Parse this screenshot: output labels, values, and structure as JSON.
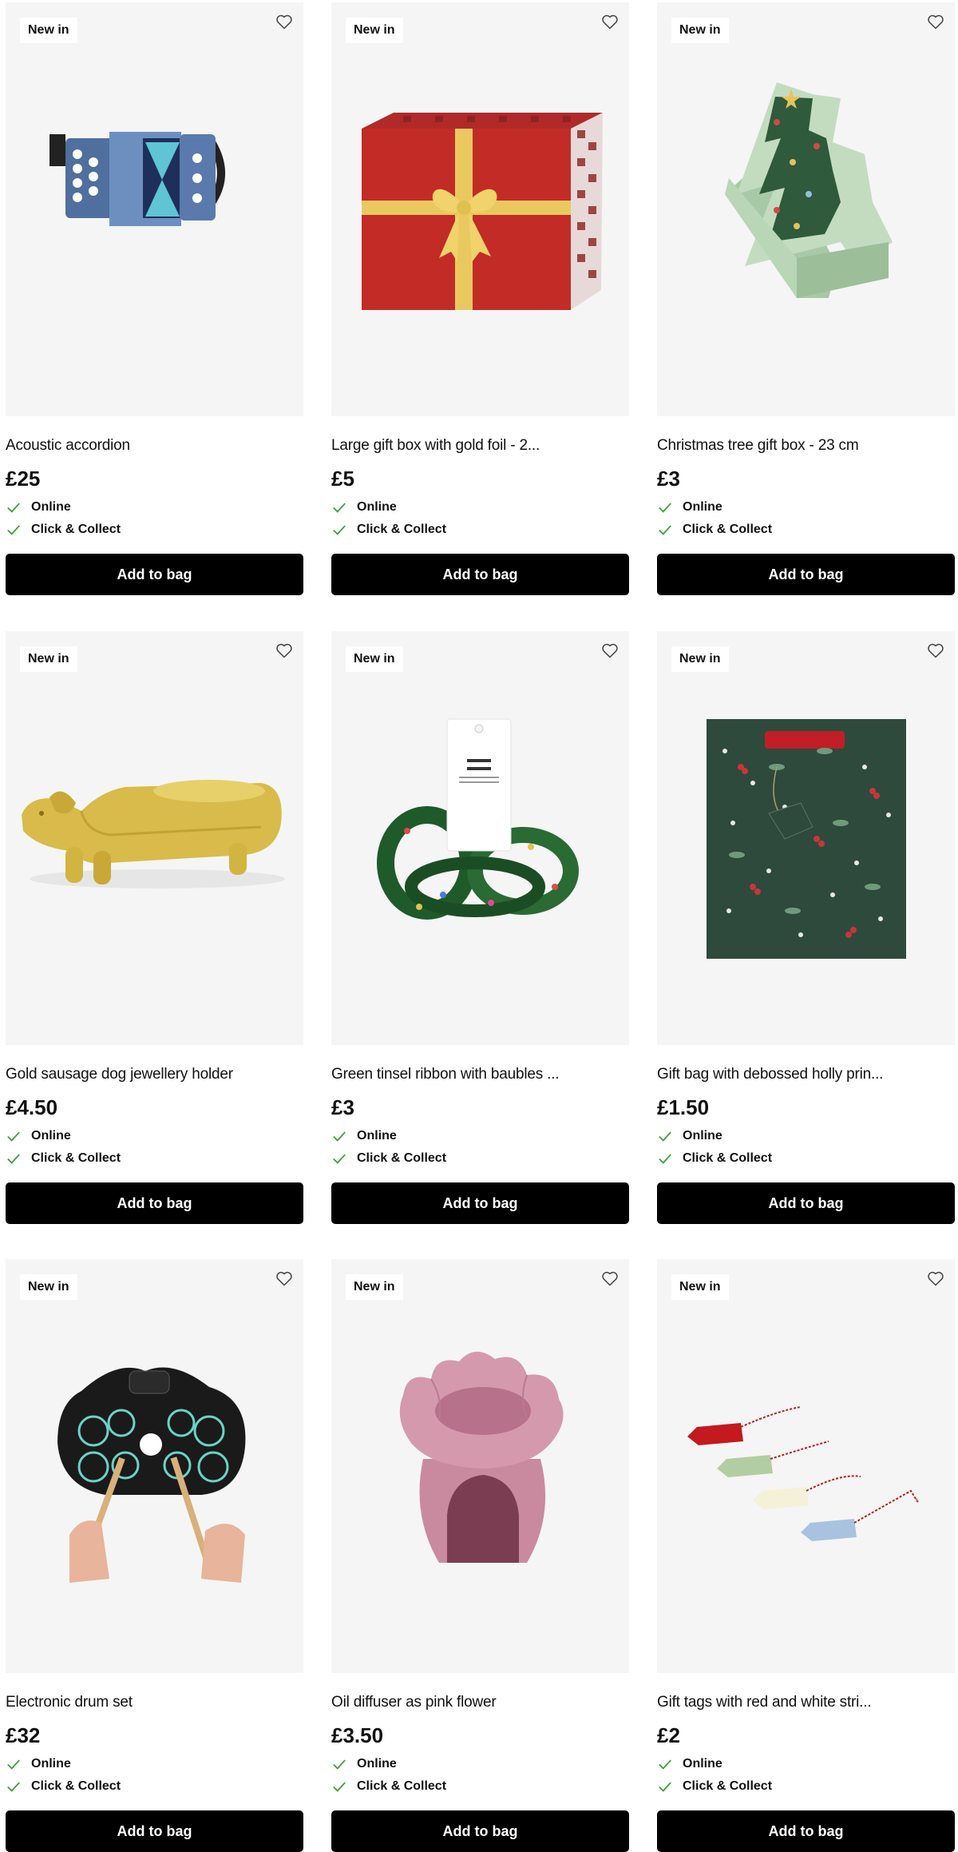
{
  "colors": {
    "button_bg": "#000000",
    "button_text": "#ffffff",
    "check": "#3aa335",
    "image_bg": "#f5f5f5"
  },
  "products": [
    {
      "badge": "New in",
      "title": "Acoustic accordion",
      "price": "£25",
      "availability": [
        "Online",
        "Click & Collect"
      ],
      "button": "Add to bag",
      "image_icon": "accordion-image"
    },
    {
      "badge": "New in",
      "title": "Large gift box with gold foil - 2...",
      "price": "£5",
      "availability": [
        "Online",
        "Click & Collect"
      ],
      "button": "Add to bag",
      "image_icon": "gift-box-image"
    },
    {
      "badge": "New in",
      "title": "Christmas tree gift box - 23 cm",
      "price": "£3",
      "availability": [
        "Online",
        "Click & Collect"
      ],
      "button": "Add to bag",
      "image_icon": "tree-gift-box-image"
    },
    {
      "badge": "New in",
      "title": "Gold sausage dog jewellery holder",
      "price": "£4.50",
      "availability": [
        "Online",
        "Click & Collect"
      ],
      "button": "Add to bag",
      "image_icon": "sausage-dog-image"
    },
    {
      "badge": "New in",
      "title": "Green tinsel ribbon with baubles ...",
      "price": "£3",
      "availability": [
        "Online",
        "Click & Collect"
      ],
      "button": "Add to bag",
      "image_icon": "tinsel-ribbon-image"
    },
    {
      "badge": "New in",
      "title": "Gift bag with debossed holly prin...",
      "price": "£1.50",
      "availability": [
        "Online",
        "Click & Collect"
      ],
      "button": "Add to bag",
      "image_icon": "gift-bag-image"
    },
    {
      "badge": "New in",
      "title": "Electronic drum set",
      "price": "£32",
      "availability": [
        "Online",
        "Click & Collect"
      ],
      "button": "Add to bag",
      "image_icon": "drum-set-image"
    },
    {
      "badge": "New in",
      "title": "Oil diffuser as pink flower",
      "price": "£3.50",
      "availability": [
        "Online",
        "Click & Collect"
      ],
      "button": "Add to bag",
      "image_icon": "oil-diffuser-image"
    },
    {
      "badge": "New in",
      "title": "Gift tags with red and white stri...",
      "price": "£2",
      "availability": [
        "Online",
        "Click & Collect"
      ],
      "button": "Add to bag",
      "image_icon": "gift-tags-image"
    }
  ]
}
